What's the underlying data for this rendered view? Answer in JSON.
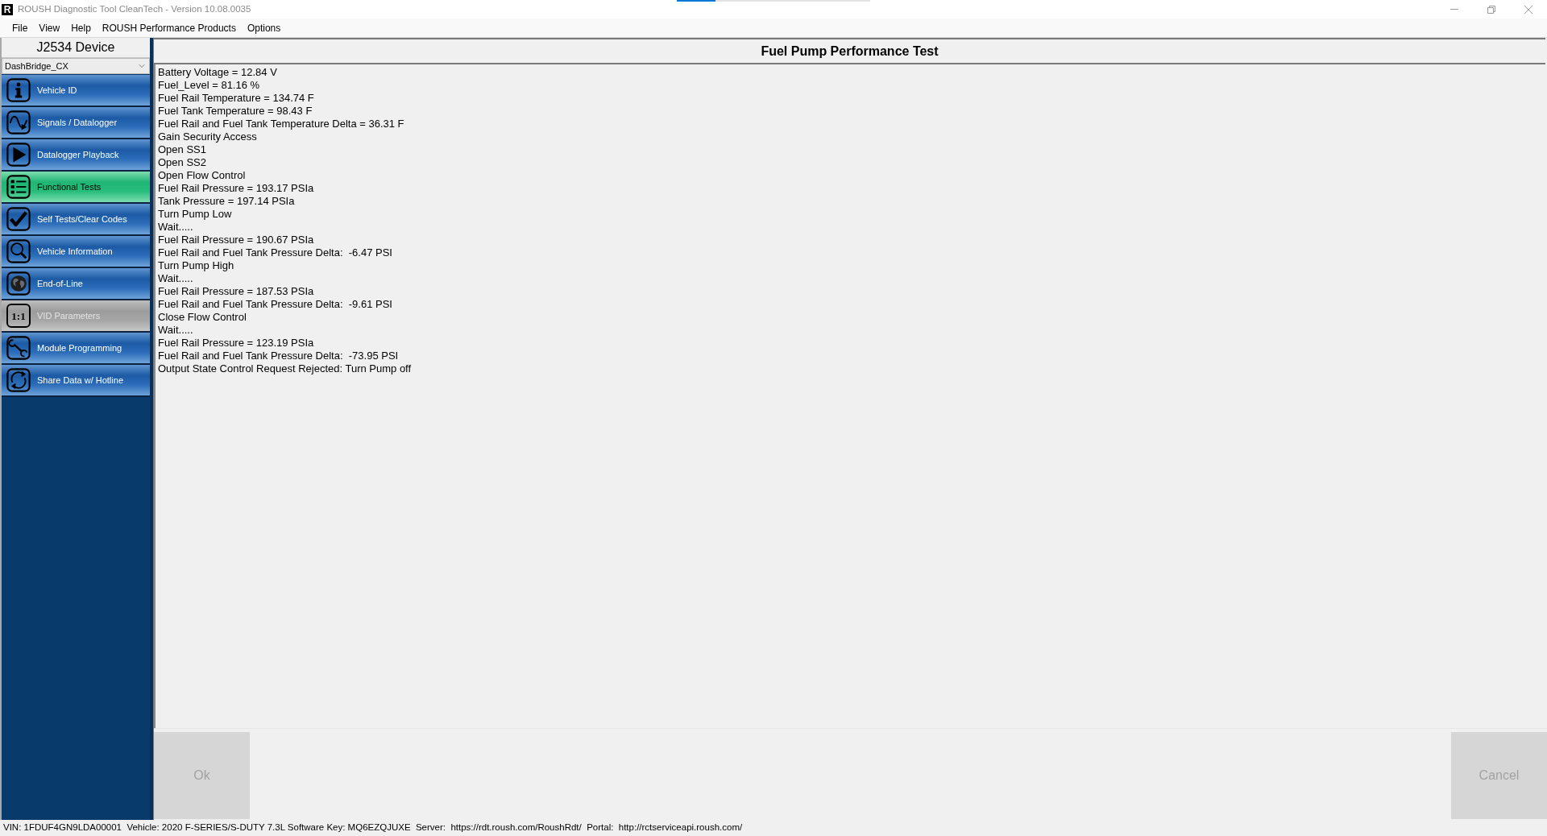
{
  "window": {
    "icon_text": "R",
    "title": "ROUSH Diagnostic Tool CleanTech - Version 10.08.0035",
    "progress": {
      "level": 0.2
    }
  },
  "menu": [
    "File",
    "View",
    "Help",
    "ROUSH Performance Products",
    "Options"
  ],
  "sidebar": {
    "header": "J2534 Device",
    "device_select": {
      "value": "DashBridge_CX"
    },
    "items": [
      {
        "label": "Vehicle ID",
        "selected": false,
        "disabled": false
      },
      {
        "label": "Signals / Datalogger",
        "selected": false,
        "disabled": false
      },
      {
        "label": "Datalogger Playback",
        "selected": false,
        "disabled": false
      },
      {
        "label": "Functional Tests",
        "selected": true,
        "disabled": false
      },
      {
        "label": "Self Tests/Clear Codes",
        "selected": false,
        "disabled": false
      },
      {
        "label": "Vehicle Information",
        "selected": false,
        "disabled": false
      },
      {
        "label": "End-of-Line",
        "selected": false,
        "disabled": false
      },
      {
        "label": "VID Parameters",
        "selected": false,
        "disabled": true,
        "icon_text": "1:1"
      },
      {
        "label": "Module Programming",
        "selected": false,
        "disabled": false
      },
      {
        "label": "Share Data w/ Hotline",
        "selected": false,
        "disabled": false
      }
    ]
  },
  "panel": {
    "title": "Fuel Pump Performance Test",
    "log_lines": [
      "Battery Voltage = 12.84 V",
      "Fuel_Level = 81.16 %",
      "Fuel Rail Temperature = 134.74 F",
      "Fuel Tank Temperature = 98.43 F",
      "Fuel Rail and Fuel Tank Temperature Delta = 36.31 F",
      "Gain Security Access",
      "Open SS1",
      "Open SS2",
      "Open Flow Control",
      "Fuel Rail Pressure = 193.17 PSIa",
      "Tank Pressure = 197.14 PSIa",
      "Turn Pump Low",
      "Wait.....",
      "Fuel Rail Pressure = 190.67 PSIa",
      "Fuel Rail and Fuel Tank Pressure Delta:  -6.47 PSI",
      "Turn Pump High",
      "Wait.....",
      "Fuel Rail Pressure = 187.53 PSIa",
      "Fuel Rail and Fuel Tank Pressure Delta:  -9.61 PSI",
      "Close Flow Control",
      "Wait.....",
      "Fuel Rail Pressure = 123.19 PSIa",
      "Fuel Rail and Fuel Tank Pressure Delta:  -73.95 PSI",
      "Output State Control Request Rejected: Turn Pump off"
    ]
  },
  "buttons": [
    {
      "label": "Ok",
      "disabled": true
    },
    {
      "label": "Cancel",
      "disabled": true
    }
  ],
  "status_bar": "VIN: 1FDUF4GN9LDA00001  Vehicle: 2020 F-SERIES/S-DUTY 7.3L Software Key: MQ6EZQJUXE  Server:  https://rdt.roush.com/RoushRdt/  Portal:  http://rctserviceapi.roush.com/"
}
